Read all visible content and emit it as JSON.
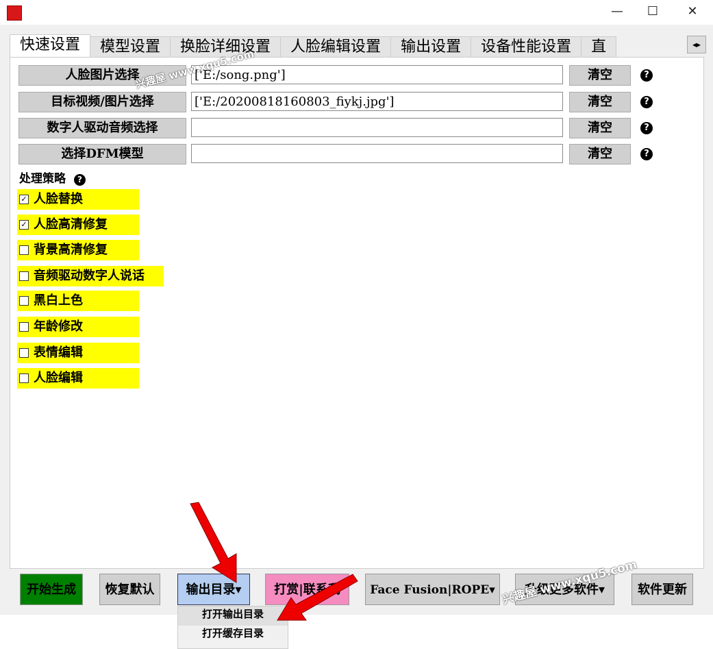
{
  "window": {
    "minimize": "—",
    "maximize": "☐",
    "close": "✕"
  },
  "tabs": [
    "快速设置",
    "模型设置",
    "换脸详细设置",
    "人脸编辑设置",
    "输出设置",
    "设备性能设置",
    "直"
  ],
  "tab_scroll": "◂▸",
  "rows": [
    {
      "label": "人脸图片选择",
      "value": "['E:/song.png']",
      "clear": "清空"
    },
    {
      "label": "目标视频/图片选择",
      "value": "['E:/20200818160803_fiykj.jpg']",
      "clear": "清空"
    },
    {
      "label": "数字人驱动音频选择",
      "value": "",
      "clear": "清空"
    },
    {
      "label": "选择DFM模型",
      "value": "",
      "clear": "清空"
    }
  ],
  "help": "?",
  "strategy_label": "处理策略",
  "options": [
    {
      "label": "人脸替换",
      "checked": true,
      "mark": "✓"
    },
    {
      "label": "人脸高清修复",
      "checked": true,
      "mark": "✓"
    },
    {
      "label": "背景高清修复",
      "checked": false,
      "mark": ""
    },
    {
      "label": "音频驱动数字人说话",
      "checked": false,
      "mark": ""
    },
    {
      "label": "黑白上色",
      "checked": false,
      "mark": ""
    },
    {
      "label": "年龄修改",
      "checked": false,
      "mark": ""
    },
    {
      "label": "表情编辑",
      "checked": false,
      "mark": ""
    },
    {
      "label": "人脸编辑",
      "checked": false,
      "mark": ""
    }
  ],
  "bottom": {
    "start": "开始生成",
    "reset": "恢复默认",
    "output_dir": "输出目录▾",
    "donate": "打赏|联系我",
    "facefusion": "Face Fusion|ROPE▾",
    "more": "升级更多软件▾",
    "update": "软件更新"
  },
  "menu": [
    "打开输出目录",
    "打开缓存目录"
  ],
  "watermark": "兴趣屋 www.xqu5.com",
  "colors": {
    "start": "#008000",
    "output_dir": "#b4cdf0",
    "donate": "#f48cc0",
    "option_bg": "#ffff00"
  }
}
